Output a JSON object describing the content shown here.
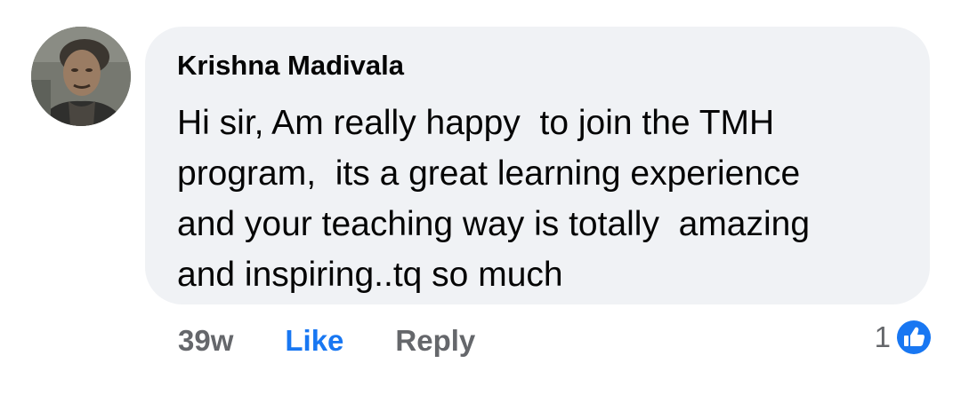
{
  "comment": {
    "author": "Krishna Madivala",
    "text": "Hi sir, Am really happy  to join the TMH\nprogram,  its a great learning experience\nand your teaching way is totally  amazing\nand inspiring..tq so much",
    "timestamp": "39w",
    "like_label": "Like",
    "reply_label": "Reply",
    "reaction_count": "1",
    "reaction_icon": "thumbs-up-icon",
    "avatar_icon": "profile-photo"
  },
  "colors": {
    "bubble_background": "#f0f2f5",
    "text": "#050505",
    "secondary_text": "#65676b",
    "accent": "#1877f2"
  }
}
